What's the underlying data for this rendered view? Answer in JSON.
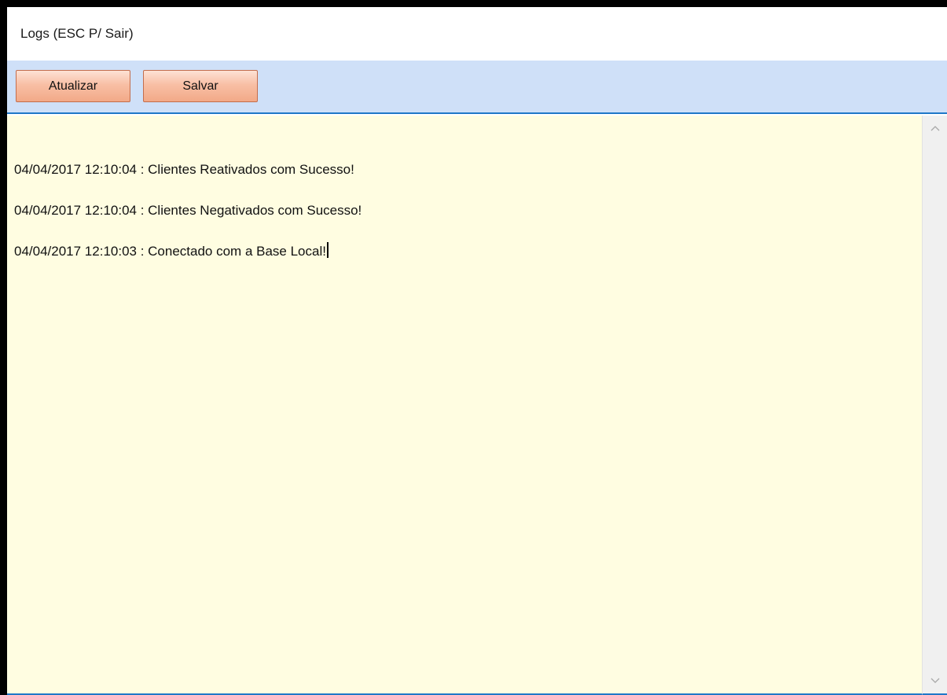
{
  "window": {
    "title": "Logs (ESC P/ Sair)"
  },
  "toolbar": {
    "buttons": [
      {
        "label": "Atualizar"
      },
      {
        "label": "Salvar"
      }
    ]
  },
  "log": {
    "lines": [
      "04/04/2017 12:10:04 : Clientes Reativados com Sucesso!",
      "04/04/2017 12:10:04 : Clientes Negativados com Sucesso!",
      "04/04/2017 12:10:03 : Conectado com a Base Local!"
    ]
  },
  "scrollbar": {
    "up_icon": "chevron-up-icon",
    "down_icon": "chevron-down-icon"
  },
  "colors": {
    "toolbar_bg": "#cfe0f8",
    "accent_border": "#1f78c8",
    "log_bg": "#fffde1",
    "button_fill": "#f8bfa5",
    "button_border": "#c36d4c"
  }
}
